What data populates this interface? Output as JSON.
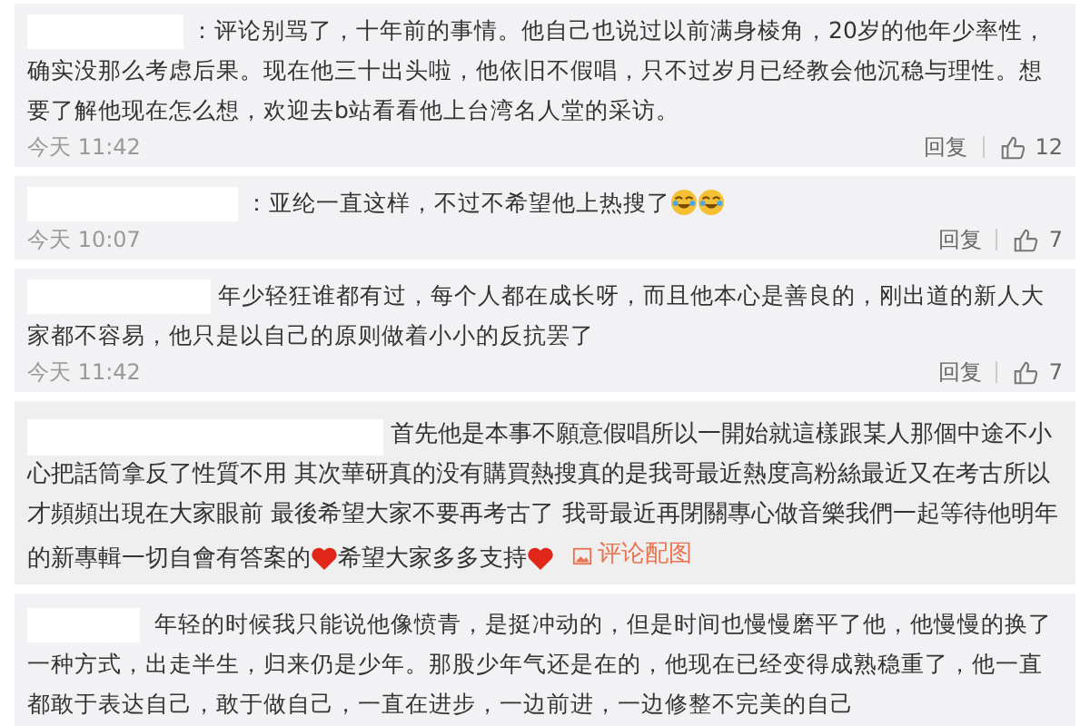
{
  "comments": [
    {
      "parts": [
        {
          "kind": "text",
          "text": "：评论别骂了，十年前的事情。他自己也说过以前满身棱角，20岁的他年少率性，确实没那么考虑后果。现在他三十出头啦，他依旧不假唱，只不过岁月已经教会他沉稳与理性。想要了解他现在怎么想，欢迎去b站看看他上台湾名人堂的采访。"
        }
      ],
      "time": "今天 11:42",
      "reply": "回复",
      "likes": "12"
    },
    {
      "parts": [
        {
          "kind": "text",
          "text": "：亚纶一直这样，不过不希望他上热搜了"
        },
        {
          "kind": "laugh"
        },
        {
          "kind": "laugh"
        }
      ],
      "time": "今天 10:07",
      "reply": "回复",
      "likes": "7"
    },
    {
      "parts": [
        {
          "kind": "text",
          "text": "年少轻狂谁都有过，每个人都在成长呀，而且他本心是善良的，刚出道的新人大家都不容易，他只是以自己的原则做着小小的反抗罢了"
        }
      ],
      "time": "今天 11:42",
      "reply": "回复",
      "likes": "7"
    },
    {
      "parts": [
        {
          "kind": "text",
          "text": "首先他是本事不願意假唱所以一開始就這樣跟某人那個中途不小心把話筒拿反了性質不用 其次華研真的没有購買熱搜真的是我哥最近熱度高粉絲最近又在考古所以才頻頻出現在大家眼前 最後希望大家不要再考古了 我哥最近再閉關專心做音樂我們一起等待他明年的新專輯一切自會有答案的"
        },
        {
          "kind": "heart"
        },
        {
          "kind": "text",
          "text": "希望大家多多支持"
        },
        {
          "kind": "heart"
        },
        {
          "kind": "link",
          "text": "评论配图"
        }
      ]
    },
    {
      "parts": [
        {
          "kind": "text",
          "text": "年轻的时候我只能说他像愤青，是挺冲动的，但是时间也慢慢磨平了他，他慢慢的换了一种方式，出走半生，归来仍是少年。那股少年气还是在的，他现在已经变得成熟稳重了，他一直都敢于表达自己，敢于做自己，一直在进步，一边前进，一边修整不完美的自己"
        }
      ]
    }
  ]
}
